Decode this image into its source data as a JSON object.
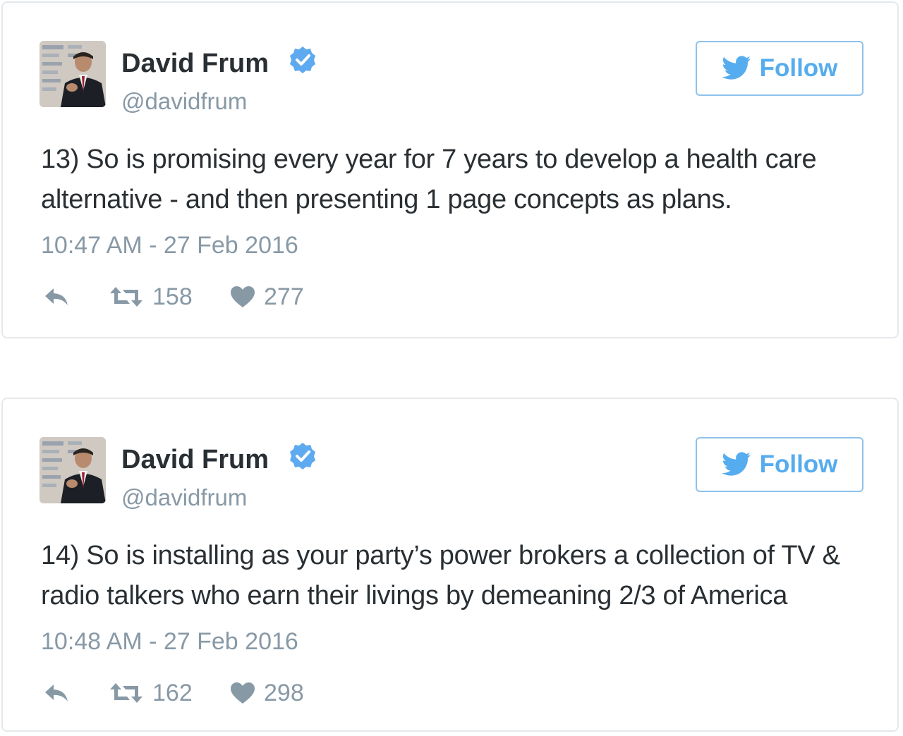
{
  "tweets": [
    {
      "author_name": "David Frum",
      "handle": "@davidfrum",
      "follow_label": "Follow",
      "text": "13) So is promising every year for 7 years to develop a health care alternative - and then presenting 1 page concepts as plans.",
      "timestamp": "10:47 AM - 27 Feb 2016",
      "retweets": "158",
      "likes": "277"
    },
    {
      "author_name": "David Frum",
      "handle": "@davidfrum",
      "follow_label": "Follow",
      "text": "14) So is installing as your party’s power brokers a collection of TV & radio talkers who earn their livings by demeaning 2/3 of America",
      "timestamp": "10:48 AM - 27 Feb 2016",
      "retweets": "162",
      "likes": "298"
    }
  ],
  "icons": {
    "verified": "verified-badge-icon",
    "follow": "bird-icon",
    "reply": "reply-icon",
    "retweet": "retweet-icon",
    "like": "heart-icon"
  },
  "colors": {
    "accent": "#55acee",
    "text": "#292f33",
    "muted": "#8899a6",
    "border": "#e4e8eb"
  }
}
